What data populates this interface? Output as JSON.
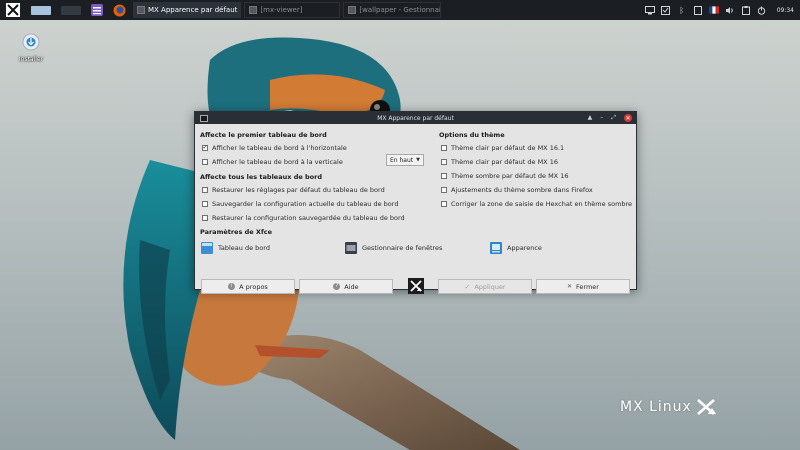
{
  "panel": {
    "tasks": [
      {
        "label": "MX Apparence par défaut",
        "active": true
      },
      {
        "label": "[mx-viewer]",
        "active": false
      },
      {
        "label": "[wallpaper - Gestionnair...",
        "active": false
      }
    ],
    "clock": "09:34"
  },
  "desktop": {
    "install_label": "Installer",
    "brand": "MX Linux"
  },
  "dialog": {
    "title": "MX Apparence par défaut",
    "left": {
      "section1_title": "Affecte le premier tableau de bord",
      "opt_horizontal": "Afficher le tableau de bord à l'horizontale",
      "opt_horizontal_checked": true,
      "opt_vertical": "Afficher le tableau de bord à la verticale",
      "opt_vertical_checked": false,
      "position_value": "En haut",
      "section2_title": "Affecte tous les tableaux de bord",
      "opt_restore_default": "Restaurer les réglages par défaut du tableau de bord",
      "opt_save_config": "Sauvegarder la configuration actuelle du tableau de bord",
      "opt_restore_saved": "Restaurer la configuration sauvegardée du tableau de bord"
    },
    "right": {
      "section_title": "Options du thème",
      "opt_light_161": "Thème clair par défaut de MX 16.1",
      "opt_light_16": "Thème clair par défaut de MX 16",
      "opt_dark_16": "Thème sombre par défaut de MX 16",
      "opt_firefox": "Ajustements du thème sombre dans Firefox",
      "opt_hexchat": "Corriger la zone de saisie de Hexchat en thème sombre"
    },
    "xfce": {
      "title": "Paramètres de Xfce",
      "panel": "Tableau de bord",
      "wm": "Gestionnaire de fenêtres",
      "appearance": "Apparence"
    },
    "buttons": {
      "about": "A propos",
      "help": "Aide",
      "apply": "Appliquer",
      "close": "Fermer"
    }
  },
  "colors": {
    "panel_bg": "#1b1f24",
    "dialog_bg": "#e4e4e4",
    "titlebar_bg": "#2a2f35",
    "close_red": "#d23a3a"
  }
}
